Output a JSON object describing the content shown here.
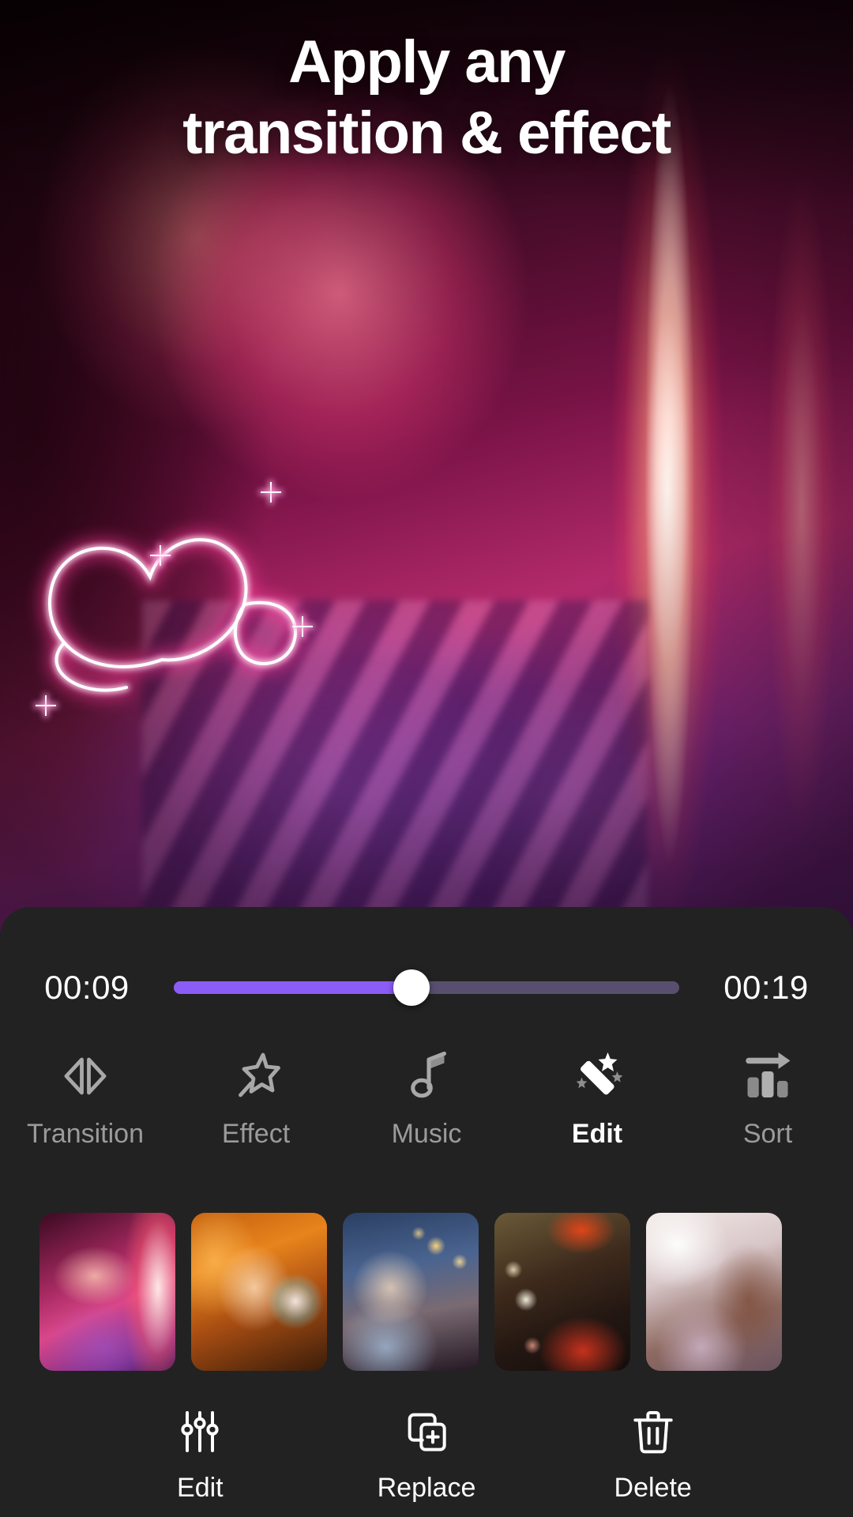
{
  "headline": {
    "line1": "Apply any",
    "line2": "transition & effect"
  },
  "preview": {
    "overlay_effect": "neon-heart-sparkle"
  },
  "timeline": {
    "current_time": "00:09",
    "total_time": "00:19",
    "progress_percent": 47,
    "fill_color": "#8b5cf6",
    "track_color": "#584f70",
    "thumb_color": "#ffffff"
  },
  "toolbar": {
    "active_index": 3,
    "items": [
      {
        "label": "Transition",
        "icon": "transition-icon",
        "active": false
      },
      {
        "label": "Effect",
        "icon": "magic-star-icon",
        "active": false
      },
      {
        "label": "Music",
        "icon": "music-note-icon",
        "active": false
      },
      {
        "label": "Edit",
        "icon": "magic-wand-icon",
        "active": true
      },
      {
        "label": "Sort",
        "icon": "sort-bars-arrow-icon",
        "active": false
      }
    ]
  },
  "clips": [
    {
      "name": "clip-1",
      "description": "pink neon portrait"
    },
    {
      "name": "clip-2",
      "description": "orange neon portrait"
    },
    {
      "name": "clip-3",
      "description": "winter blue bokeh portrait"
    },
    {
      "name": "clip-4",
      "description": "warm bokeh reindeer portrait"
    },
    {
      "name": "clip-5",
      "description": "light pastel portrait"
    }
  ],
  "actions": [
    {
      "label": "Edit",
      "icon": "sliders-icon"
    },
    {
      "label": "Replace",
      "icon": "replace-plus-icon"
    },
    {
      "label": "Delete",
      "icon": "trash-icon"
    }
  ],
  "colors": {
    "panel_bg": "#222222",
    "accent_purple": "#8b5cf6",
    "label_inactive": "#9b9b9b",
    "label_active": "#ffffff"
  }
}
